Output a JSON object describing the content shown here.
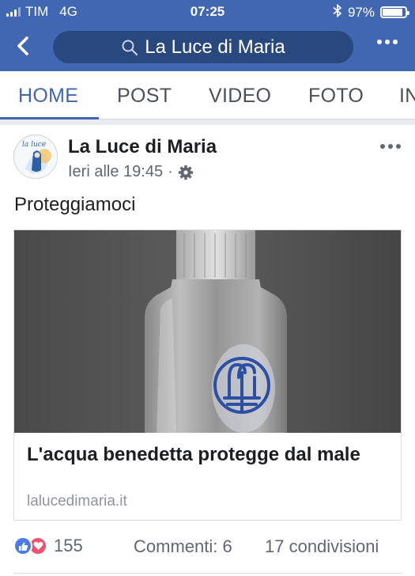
{
  "status_bar": {
    "carrier": "TIM",
    "network": "4G",
    "time": "07:25",
    "battery": "97%",
    "battery_level": 0.97
  },
  "header": {
    "search_text": "La Luce di Maria",
    "icons": {
      "back": "chevron-left-icon",
      "search": "search-icon",
      "more": "more-icon"
    }
  },
  "tabs": [
    {
      "label": "HOME",
      "active": true
    },
    {
      "label": "POST",
      "active": false
    },
    {
      "label": "VIDEO",
      "active": false
    },
    {
      "label": "FOTO",
      "active": false
    },
    {
      "label": "IN",
      "active": false
    }
  ],
  "post": {
    "page_name": "La Luce di Maria",
    "timestamp": "Ieri alle 19:45",
    "separator": "·",
    "text": "Proteggiamoci",
    "avatar_text": "la luce",
    "link": {
      "title": "L'acqua benedetta protegge dal male",
      "domain": "lalucedimaria.it"
    },
    "reactions_count": "155",
    "comments": "Commenti: 6",
    "shares": "17 condivisioni"
  },
  "colors": {
    "brand": "#4267b2",
    "search_bg": "#29487d",
    "like": "#4a7be6",
    "love": "#f0506e",
    "meta_text": "#616770"
  }
}
